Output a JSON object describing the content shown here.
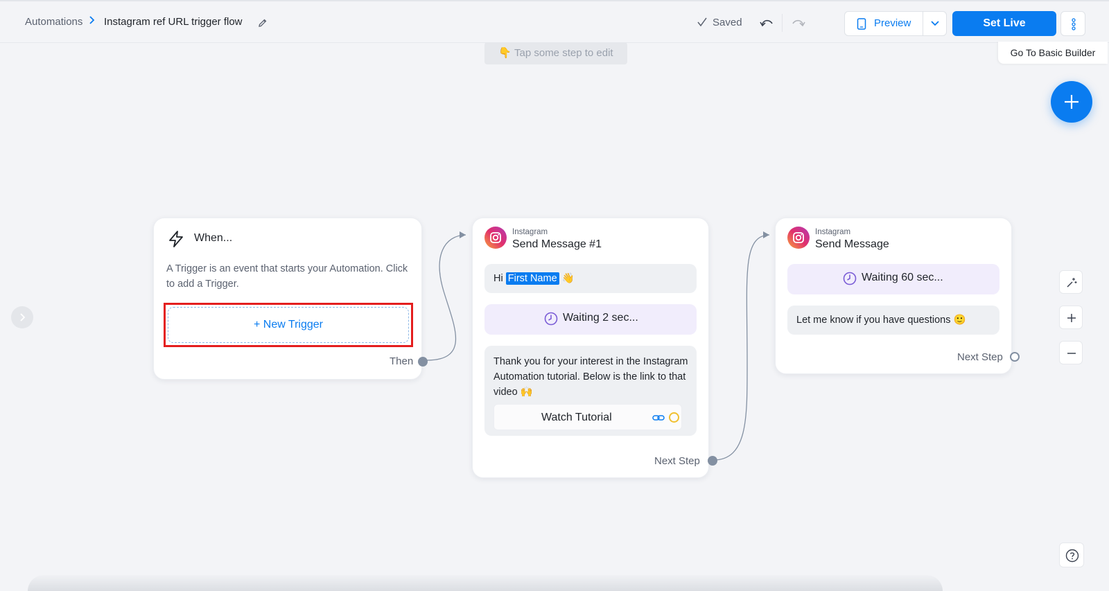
{
  "header": {
    "breadcrumb_root": "Automations",
    "flow_title": "Instagram ref URL trigger flow",
    "saved_label": "Saved",
    "preview_label": "Preview",
    "set_live_label": "Set Live"
  },
  "canvas": {
    "tip": "👇 Tap some step to edit",
    "basic_builder_label": "Go To Basic Builder"
  },
  "trigger_node": {
    "title": "When...",
    "description": "A Trigger is an event that starts your Automation. Click to add a Trigger.",
    "new_trigger_label": "+ New Trigger",
    "then_label": "Then"
  },
  "message_node_1": {
    "channel": "Instagram",
    "title": "Send Message #1",
    "greeting_prefix": "Hi",
    "first_name_chip": "First Name",
    "greeting_emoji": "👋",
    "wait_label": "Waiting 2 sec...",
    "body_text": "Thank you for your interest in the Instagram Automation tutorial. Below is the link to that video 🙌",
    "button_label": "Watch Tutorial",
    "next_label": "Next Step"
  },
  "message_node_2": {
    "channel": "Instagram",
    "title": "Send Message",
    "wait_label": "Waiting 60 sec...",
    "body_text": "Let me know if you have questions 🙂",
    "next_label": "Next Step"
  },
  "colors": {
    "accent": "#0a7cf0",
    "highlight": "#e41e1e",
    "wait_bg": "#f1edfc",
    "wait_icon": "#7a5cd6"
  },
  "icons": {
    "crumb_sep": "chevron-right-icon",
    "edit": "pencil-icon",
    "saved": "check-icon",
    "undo": "undo-icon",
    "redo": "redo-icon",
    "preview": "phone-icon",
    "trigger": "bolt-icon",
    "channel": "instagram-icon",
    "wait": "clock-icon",
    "button_link": "link-icon"
  }
}
